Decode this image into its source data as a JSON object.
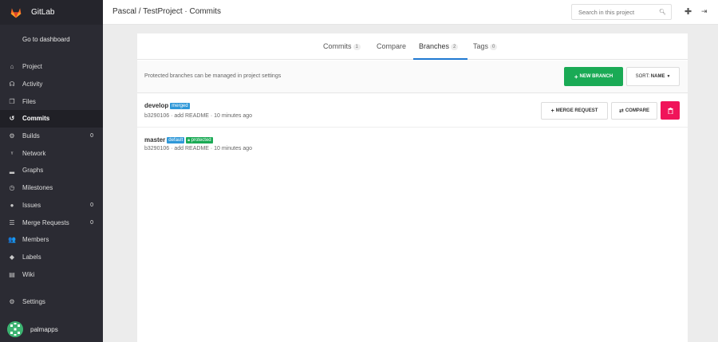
{
  "app": {
    "name": "GitLab"
  },
  "sidebar": {
    "dashboard_label": "Go to dashboard",
    "items": [
      {
        "label": "Project",
        "icon": "home-icon",
        "count": ""
      },
      {
        "label": "Activity",
        "icon": "activity-icon",
        "count": ""
      },
      {
        "label": "Files",
        "icon": "files-icon",
        "count": ""
      },
      {
        "label": "Commits",
        "icon": "history-icon",
        "count": "",
        "active": true
      },
      {
        "label": "Builds",
        "icon": "builds-icon",
        "count": "0"
      },
      {
        "label": "Network",
        "icon": "network-icon",
        "count": ""
      },
      {
        "label": "Graphs",
        "icon": "graph-icon",
        "count": ""
      },
      {
        "label": "Milestones",
        "icon": "clock-icon",
        "count": ""
      },
      {
        "label": "Issues",
        "icon": "issues-icon",
        "count": "0"
      },
      {
        "label": "Merge Requests",
        "icon": "list-icon",
        "count": "0"
      },
      {
        "label": "Members",
        "icon": "users-icon",
        "count": ""
      },
      {
        "label": "Labels",
        "icon": "tag-icon",
        "count": ""
      },
      {
        "label": "Wiki",
        "icon": "book-icon",
        "count": ""
      }
    ],
    "settings_label": "Settings",
    "username": "palmapps"
  },
  "header": {
    "breadcrumb": "Pascal / TestProject · Commits",
    "search_placeholder": "Search in this project"
  },
  "tabs": [
    {
      "label": "Commits",
      "count": "1"
    },
    {
      "label": "Compare",
      "count": ""
    },
    {
      "label": "Branches",
      "count": "2",
      "active": true
    },
    {
      "label": "Tags",
      "count": "0"
    }
  ],
  "info_bar": {
    "text": "Protected branches can be managed in project settings",
    "new_branch_label": "NEW BRANCH",
    "sort_label": "SORT: ",
    "sort_value": "NAME"
  },
  "branches": [
    {
      "name": "develop",
      "labels": [
        "merged"
      ],
      "commit": "b3290106 · add README · 10 minutes ago"
    },
    {
      "name": "master",
      "labels": [
        "default",
        "protected"
      ],
      "commit": "b3290106 · add README · 10 minutes ago"
    }
  ],
  "actions": {
    "merge_request_label": "MERGE REQUEST",
    "compare_label": "COMPARE"
  },
  "colors": {
    "sidebar_bg": "#2b2b33",
    "accent_blue": "#1f78d1",
    "success_green": "#1aaa55",
    "danger_pink": "#f0145a"
  }
}
